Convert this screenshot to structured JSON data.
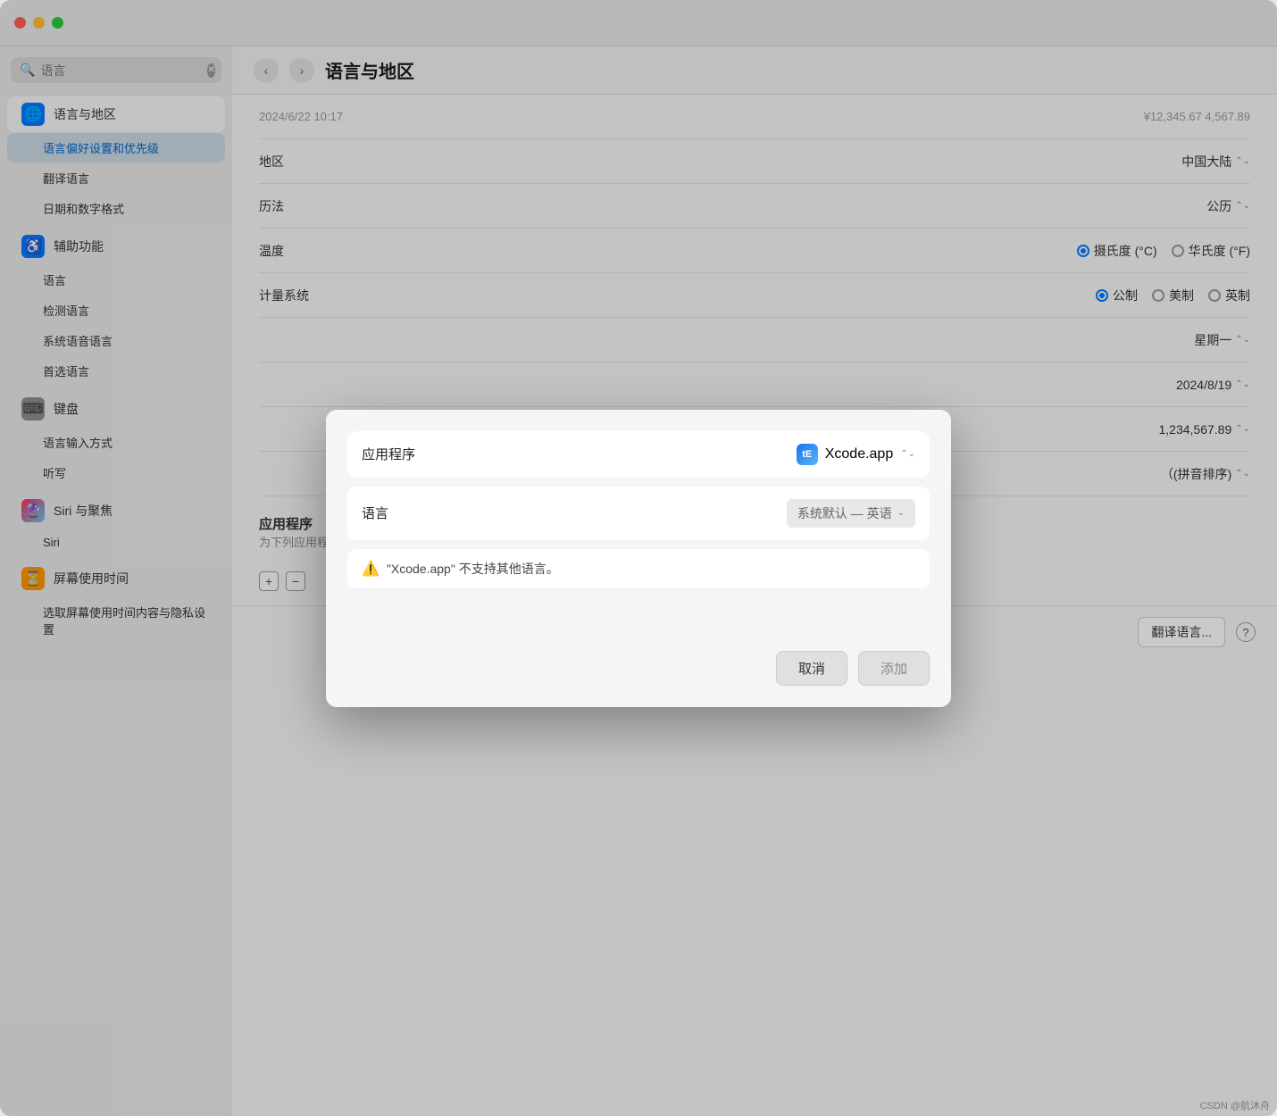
{
  "window": {
    "title": "语言与地区",
    "controls": {
      "close": "close",
      "minimize": "minimize",
      "maximize": "maximize"
    }
  },
  "sidebar": {
    "search_placeholder": "语言",
    "search_value": "语言",
    "items": [
      {
        "id": "language-region",
        "icon": "🌐",
        "label": "语言与地区",
        "icon_type": "language",
        "active": true,
        "subitems": [
          {
            "id": "language-prefs",
            "label": "语言偏好设置和优先级",
            "active_sub": true
          },
          {
            "id": "translate-language",
            "label": "翻译语言",
            "active_sub": false
          },
          {
            "id": "date-number-format",
            "label": "日期和数字格式",
            "active_sub": false
          }
        ]
      },
      {
        "id": "accessibility",
        "icon": "♿",
        "label": "辅助功能",
        "icon_type": "accessibility",
        "active": false,
        "subitems": [
          {
            "id": "acc-language",
            "label": "语言",
            "active_sub": false
          },
          {
            "id": "acc-detect",
            "label": "检测语言",
            "active_sub": false
          },
          {
            "id": "acc-voice",
            "label": "系统语音语言",
            "active_sub": false
          },
          {
            "id": "acc-preferred",
            "label": "首选语言",
            "active_sub": false
          }
        ]
      },
      {
        "id": "keyboard",
        "icon": "⌨",
        "label": "键盘",
        "icon_type": "keyboard",
        "active": false,
        "subitems": [
          {
            "id": "keyboard-input",
            "label": "语言输入方式",
            "active_sub": false
          },
          {
            "id": "keyboard-dictation",
            "label": "听写",
            "active_sub": false
          }
        ]
      },
      {
        "id": "siri",
        "icon": "🔮",
        "label": "Siri 与聚焦",
        "icon_type": "siri",
        "active": false,
        "subitems": [
          {
            "id": "siri-sub",
            "label": "Siri",
            "active_sub": false
          }
        ]
      },
      {
        "id": "screentime",
        "icon": "⏳",
        "label": "屏幕使用时间",
        "icon_type": "screentime",
        "active": false,
        "subitems": [
          {
            "id": "screentime-sub",
            "label": "选取屏幕使用时间内容与隐私设置",
            "active_sub": false
          }
        ]
      }
    ]
  },
  "nav": {
    "back_label": "‹",
    "forward_label": "›",
    "title": "语言与地区"
  },
  "main_content": {
    "rows": [
      {
        "id": "faded-row",
        "label": "2024/6/22 10:17",
        "value": "¥12,345.67    4,567.89"
      },
      {
        "id": "region",
        "label": "地区",
        "value": "中国大陆",
        "has_dropdown": true
      },
      {
        "id": "calendar",
        "label": "历法",
        "value": "公历",
        "has_dropdown": true
      },
      {
        "id": "temperature",
        "label": "温度",
        "options": [
          {
            "label": "摄氏度 (°C)",
            "selected": true
          },
          {
            "label": "华氏度 (°F)",
            "selected": false
          }
        ]
      },
      {
        "id": "measurement",
        "label": "计量系统",
        "options": [
          {
            "label": "公制",
            "selected": true
          },
          {
            "label": "美制",
            "selected": false
          },
          {
            "label": "英制",
            "selected": false
          }
        ]
      },
      {
        "id": "week-start",
        "label": "",
        "value": "星期一",
        "has_dropdown": true
      },
      {
        "id": "date-format",
        "label": "",
        "value": "2024/8/19",
        "has_dropdown": true
      },
      {
        "id": "number-format",
        "label": "",
        "value": "1,234,567.89",
        "has_dropdown": true
      },
      {
        "id": "sort-order",
        "label": "",
        "value": "（(拼音排序)",
        "has_dropdown": true
      }
    ],
    "apps_section": {
      "title": "应用程序",
      "subtitle": "为下列应用程序自定义语言设置："
    },
    "bottom_buttons": {
      "add": "+",
      "remove": "−"
    },
    "footer": {
      "translate_btn": "翻译语言...",
      "help_btn": "?"
    }
  },
  "dialog": {
    "app_row": {
      "label": "应用程序",
      "app_name": "Xcode.app",
      "app_icon_text": "tE"
    },
    "language_row": {
      "label": "语言",
      "value": "系统默认 — 英语"
    },
    "warning": {
      "icon": "⚠️",
      "text": "\"Xcode.app\" 不支持其他语言。"
    },
    "buttons": {
      "cancel": "取消",
      "add": "添加"
    }
  },
  "watermark": "CSDN @航沐舟"
}
